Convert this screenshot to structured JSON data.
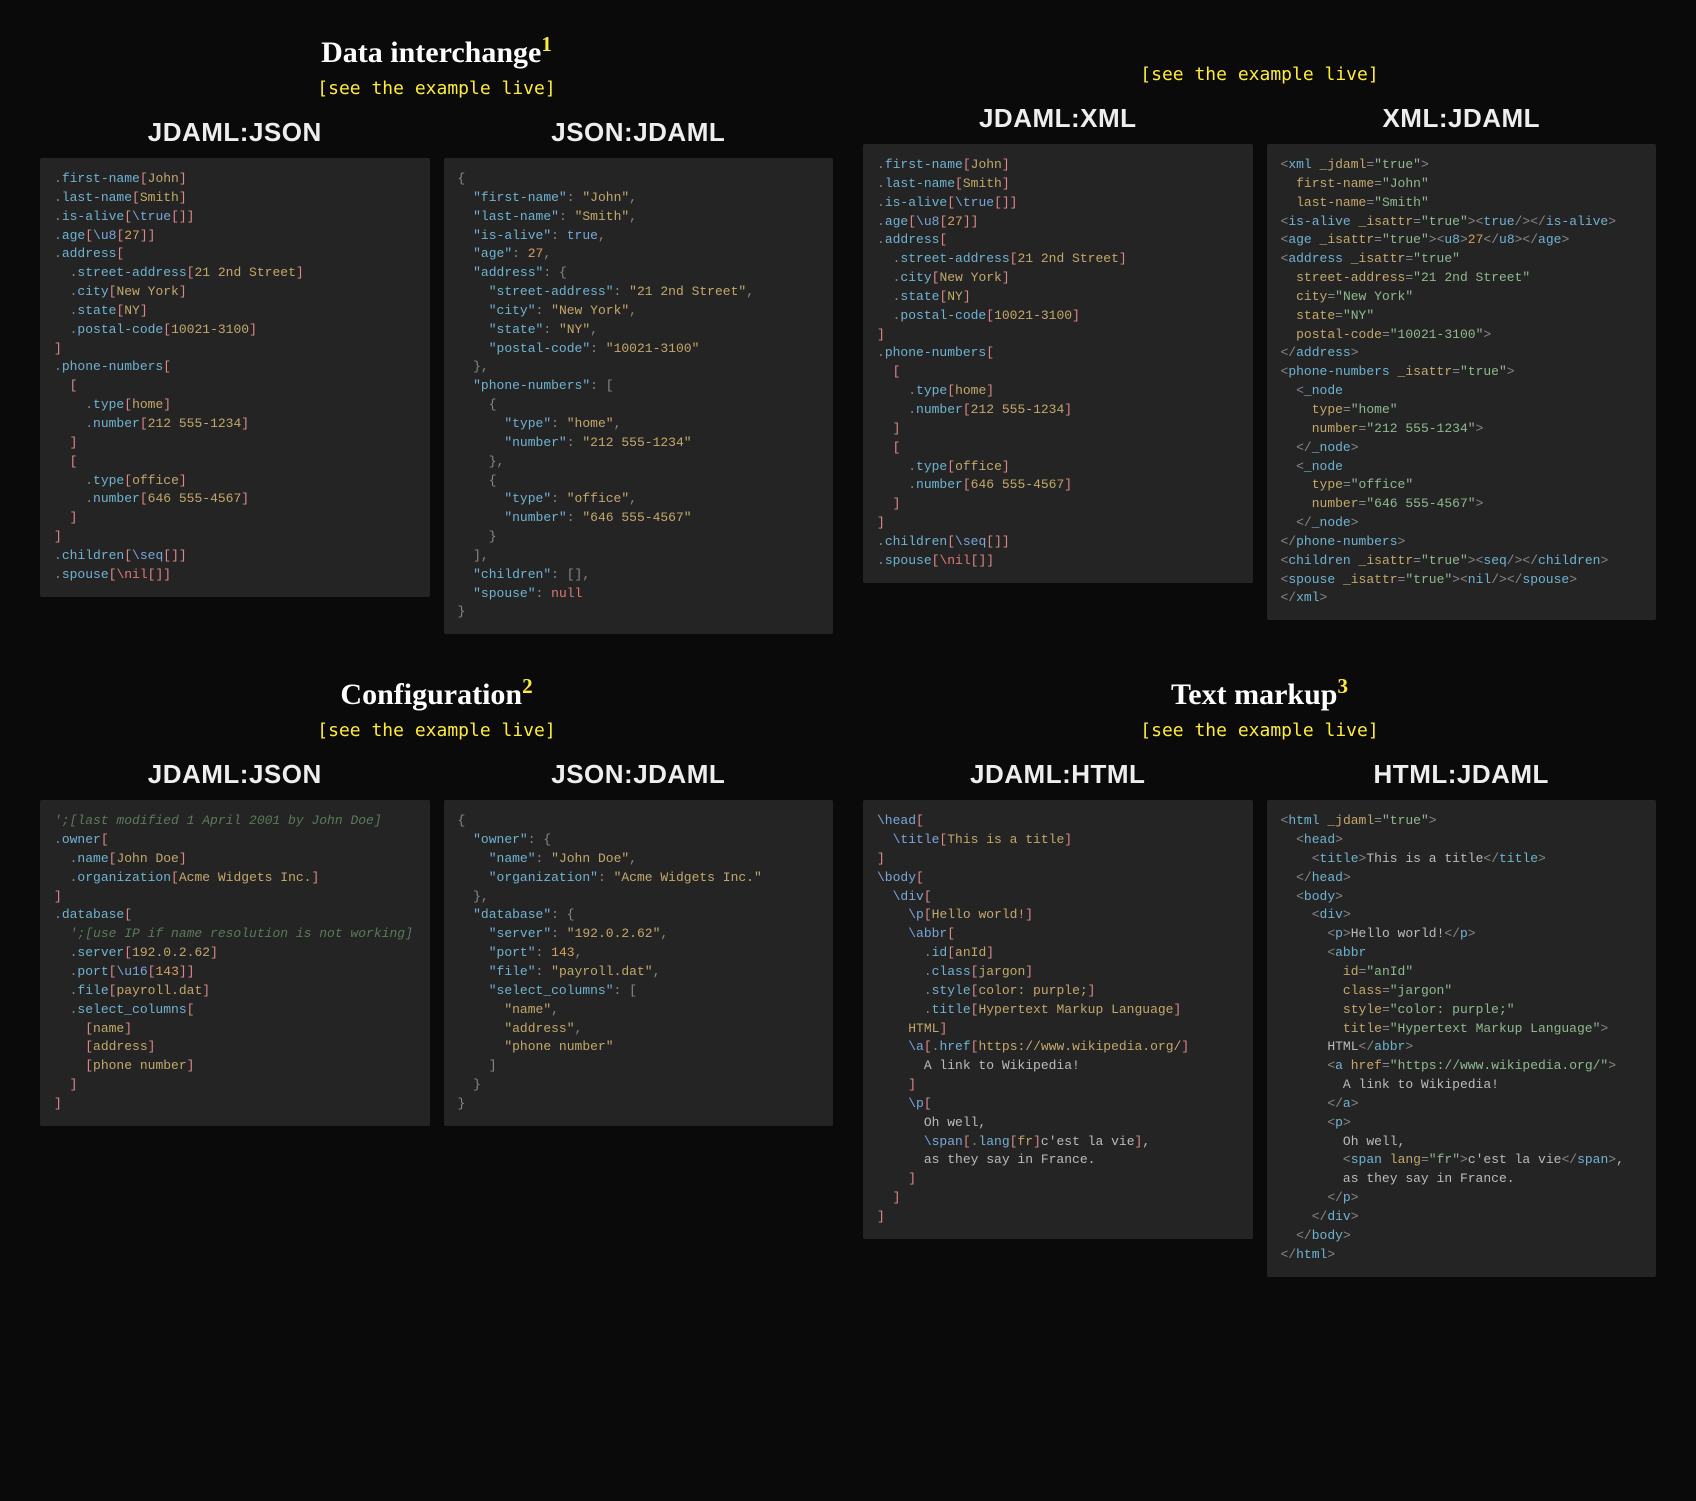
{
  "sections": {
    "data_interchange": {
      "title": "Data interchange",
      "footnote": "1",
      "see_live": "[see the example live]"
    },
    "configuration": {
      "title": "Configuration",
      "footnote": "2",
      "see_live": "[see the example live]"
    },
    "text_markup": {
      "title": "Text markup",
      "footnote": "3",
      "see_live": "[see the example live]"
    }
  },
  "headings": {
    "jdaml_json": "JDAML:JSON",
    "json_jdaml": "JSON:JDAML",
    "jdaml_xml": "JDAML:XML",
    "xml_jdaml": "XML:JDAML",
    "jdaml_html": "JDAML:HTML",
    "html_jdaml": "HTML:JDAML"
  },
  "person_data": {
    "first_name": "John",
    "last_name": "Smith",
    "is_alive": true,
    "age": 27,
    "age_type": "u8",
    "address": {
      "street_address": "21 2nd Street",
      "city": "New York",
      "state": "NY",
      "postal_code": "10021-3100"
    },
    "phone_numbers": [
      {
        "type": "home",
        "number": "212 555-1234"
      },
      {
        "type": "office",
        "number": "646 555-4567"
      }
    ],
    "children": [],
    "spouse": null
  },
  "config_data": {
    "comment1": "last modified 1 April 2001 by John Doe",
    "owner": {
      "name": "John Doe",
      "organization": "Acme Widgets Inc."
    },
    "comment2": "use IP if name resolution is not working",
    "database": {
      "server": "192.0.2.62",
      "port": 143,
      "port_type": "u16",
      "file": "payroll.dat",
      "select_columns": [
        "name",
        "address",
        "phone number"
      ]
    }
  },
  "markup_data": {
    "title": "This is a title",
    "p1": "Hello world!",
    "abbr": {
      "id": "anId",
      "class": "jargon",
      "style": "color: purple;",
      "title": "Hypertext Markup Language",
      "text": "HTML"
    },
    "a": {
      "href": "https://www.wikipedia.org/",
      "text": "A link to Wikipedia!"
    },
    "p2": {
      "pre": "Oh well,",
      "span_lang": "fr",
      "span_text": "c'est la vie",
      "post": "as they say in France."
    }
  }
}
